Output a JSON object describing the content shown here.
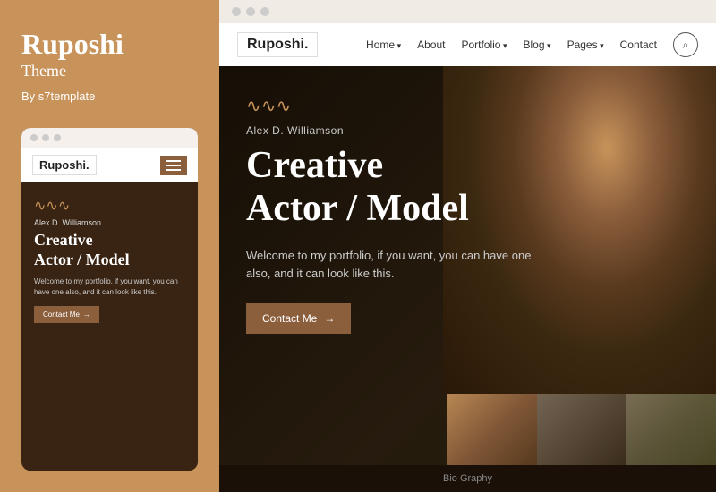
{
  "left": {
    "title": "Ruposhi",
    "subtitle": "Theme",
    "by": "By s7template",
    "mobile_logo": "Ruposhi.",
    "mobile_name": "Alex D. Williamson",
    "mobile_heading_line1": "Creative",
    "mobile_heading_line2": "Actor / Model",
    "mobile_desc": "Welcome to my portfolio, if you want, you can have one also, and it can look like this.",
    "mobile_btn": "Contact Me",
    "dots_color": "#ccc"
  },
  "right": {
    "logo": "Ruposhi.",
    "nav": {
      "items": [
        {
          "label": "Home",
          "has_arrow": true
        },
        {
          "label": "About",
          "has_arrow": false
        },
        {
          "label": "Portfolio",
          "has_arrow": true
        },
        {
          "label": "Blog",
          "has_arrow": true
        },
        {
          "label": "Pages",
          "has_arrow": true
        },
        {
          "label": "Contact",
          "has_arrow": false
        }
      ]
    },
    "hero": {
      "name": "Alex D. Williamson",
      "title_line1": "Creative",
      "title_line2": "Actor / Model",
      "description": "Welcome to my portfolio, if you want, you can have one also, and it can look like this.",
      "btn_label": "Contact Me",
      "wave": "∿∿∿"
    },
    "bottom_label": "Bio Graphy"
  }
}
